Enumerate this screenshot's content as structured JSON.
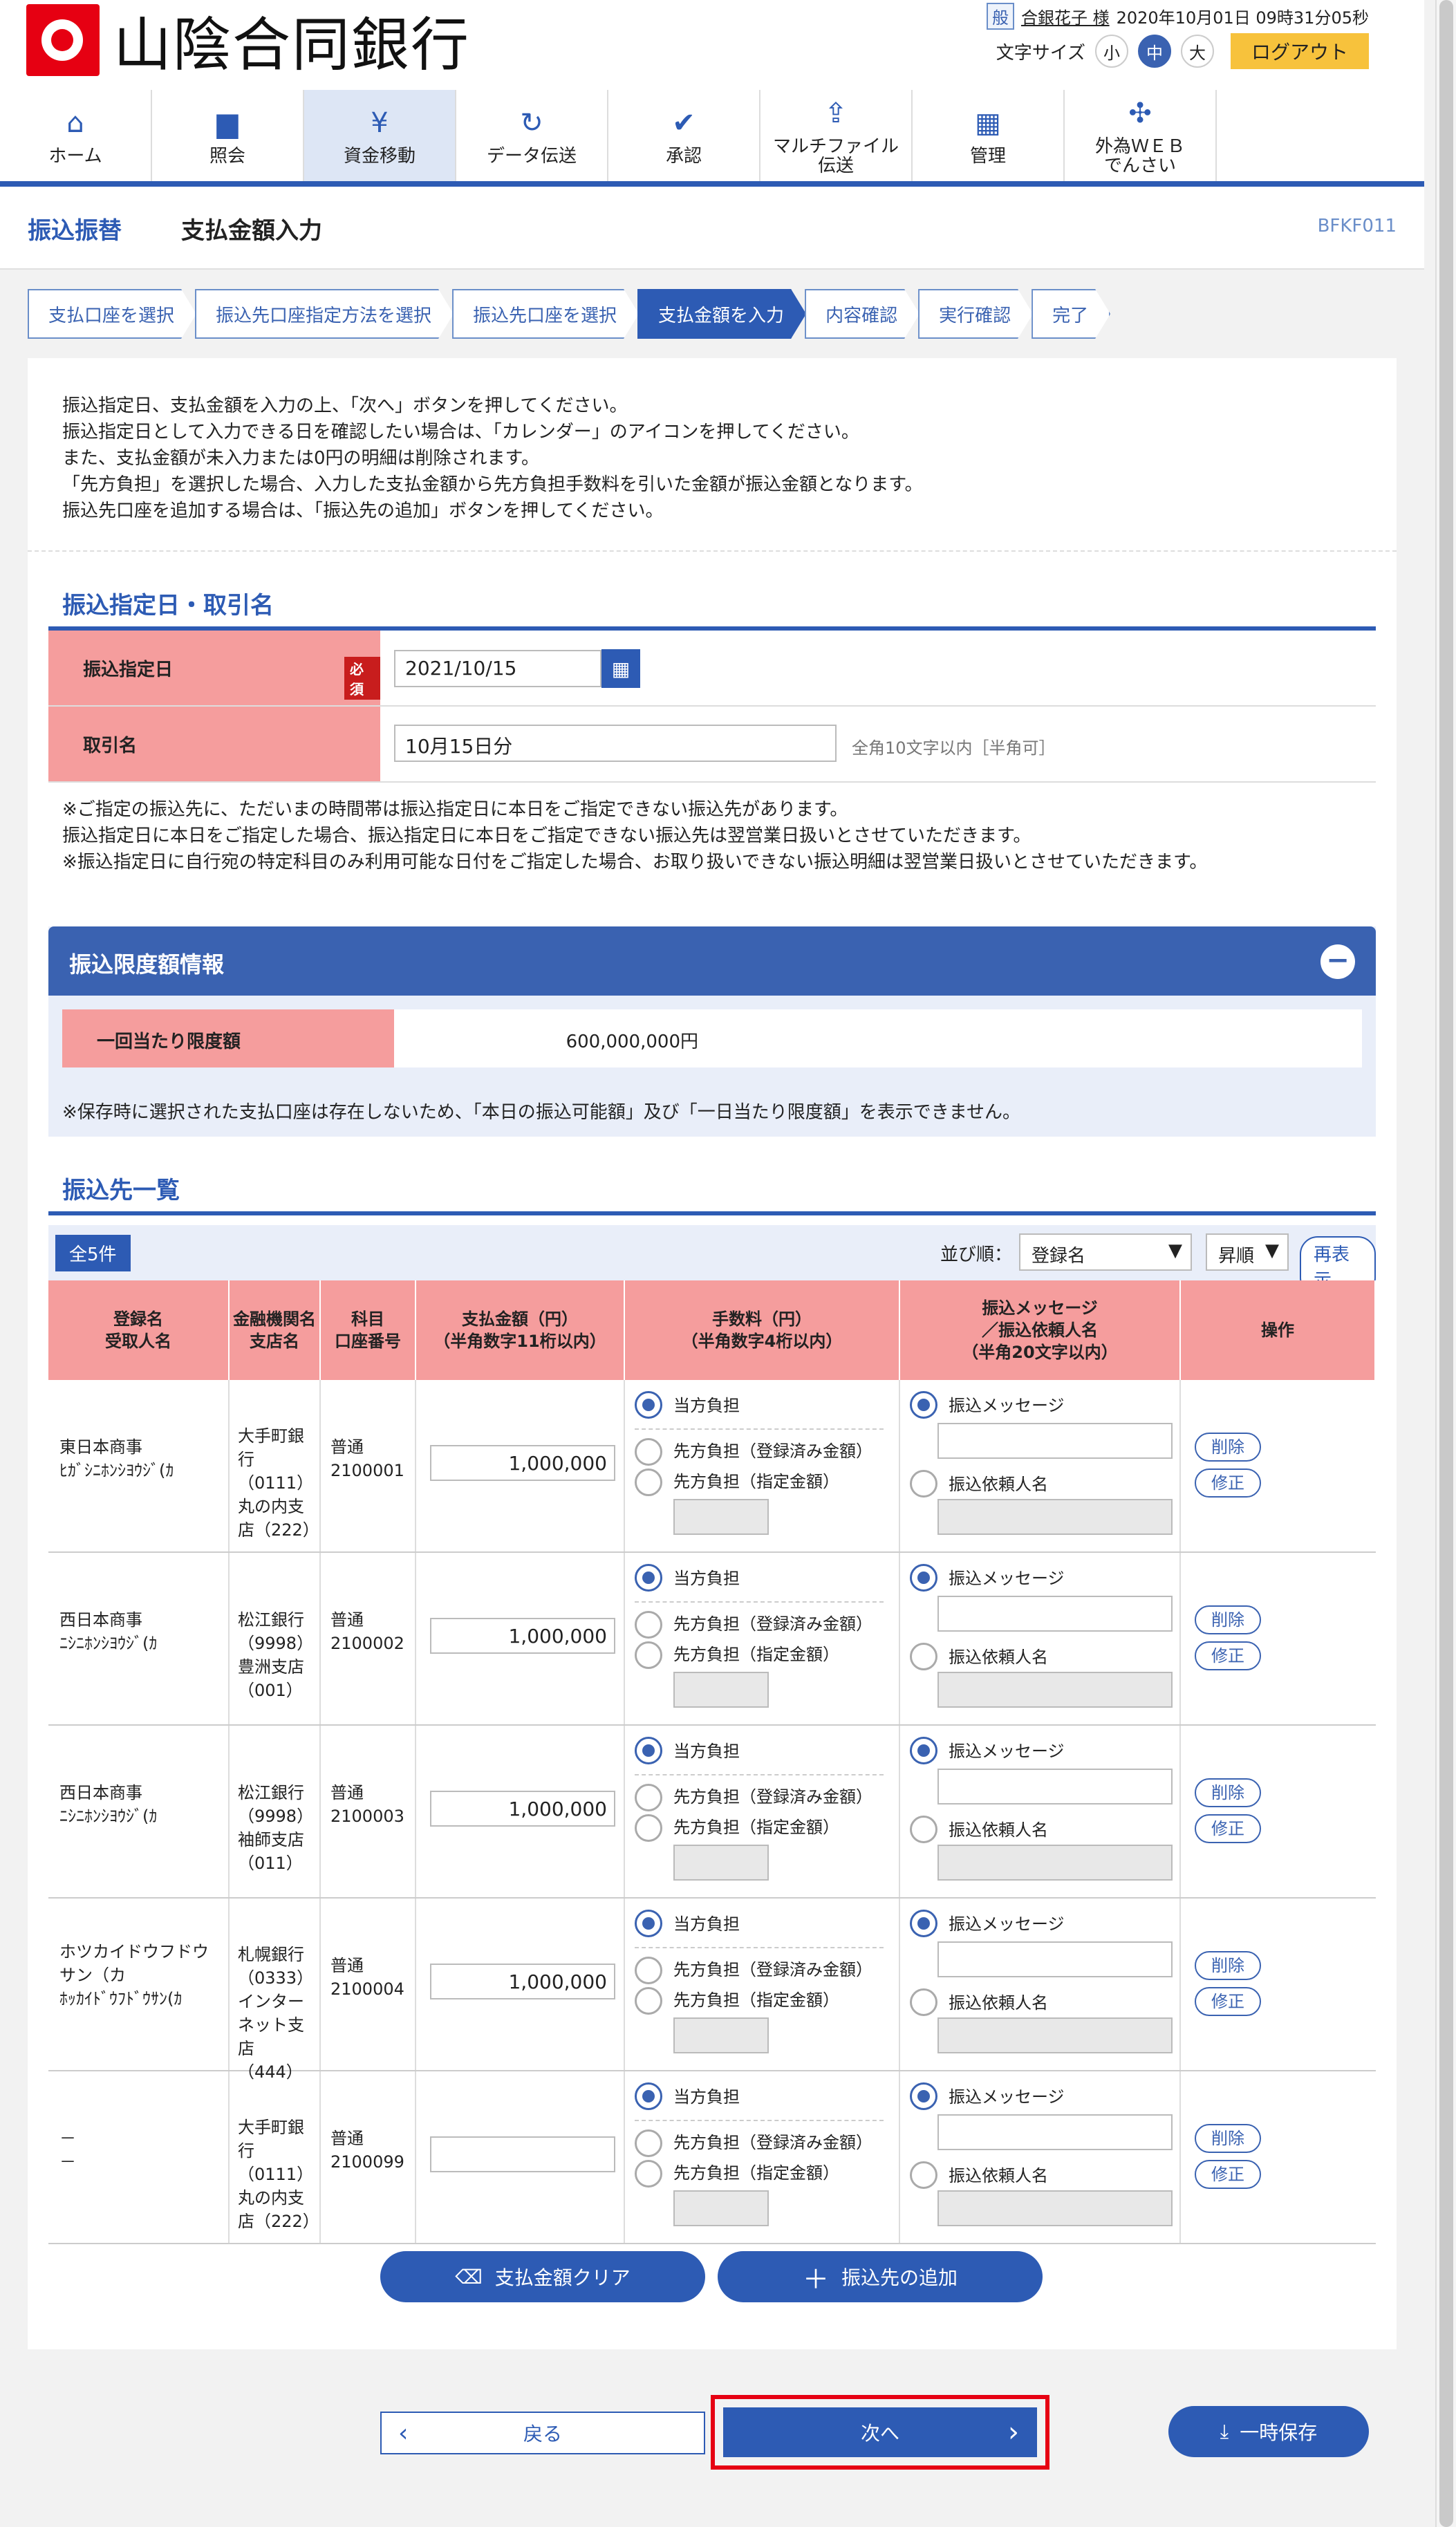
{
  "header": {
    "bank_name": "山陰合同銀行",
    "user_badge": "般",
    "user_name": "合銀花子 様",
    "datetime": "2020年10月01日 09時31分05秒",
    "font_size_label": "文字サイズ",
    "font_sizes": [
      "小",
      "中",
      "大"
    ],
    "logout": "ログアウト"
  },
  "nav": [
    {
      "label": "ホーム",
      "icon": "home-icon",
      "glyph": "⌂"
    },
    {
      "label": "照会",
      "icon": "document-icon",
      "glyph": "▆"
    },
    {
      "label": "資金移動",
      "icon": "yen-transfer-icon",
      "glyph": "¥"
    },
    {
      "label": "データ伝送",
      "icon": "refresh-icon",
      "glyph": "↻"
    },
    {
      "label": "承認",
      "icon": "approve-icon",
      "glyph": "✔"
    },
    {
      "label": "マルチファイル\n伝送",
      "icon": "file-upload-icon",
      "glyph": "⇪"
    },
    {
      "label": "管理",
      "icon": "building-icon",
      "glyph": "▦"
    },
    {
      "label": "外為ＷＥＢ\nでんさい",
      "icon": "network-icon",
      "glyph": "✣"
    }
  ],
  "page": {
    "section": "振込振替",
    "title": "支払金額入力",
    "code": "BFKF011"
  },
  "steps": [
    "支払口座を選択",
    "振込先口座指定方法を選択",
    "振込先口座を選択",
    "支払金額を入力",
    "内容確認",
    "実行確認",
    "完了"
  ],
  "instructions": [
    "振込指定日、支払金額を入力の上、「次へ」ボタンを押してください。",
    "振込指定日として入力できる日を確認したい場合は、「カレンダー」のアイコンを押してください。",
    "また、支払金額が未入力または0円の明細は削除されます。",
    "「先方負担」を選択した場合、入力した支払金額から先方負担手数料を引いた金額が振込金額となります。",
    "振込先口座を追加する場合は、「振込先の追加」ボタンを押してください。"
  ],
  "date_section": {
    "title": "振込指定日・取引名",
    "date_label": "振込指定日",
    "required": "必須",
    "date_value": "2021/10/15",
    "name_label": "取引名",
    "name_value": "10月15日分",
    "name_hint": "全角10文字以内［半角可］"
  },
  "notes": [
    "※ご指定の振込先に、ただいまの時間帯は振込指定日に本日をご指定できない振込先があります。",
    "振込指定日に本日をご指定した場合、振込指定日に本日をご指定できない振込先は翌営業日扱いとさせていただきます。",
    "※振込指定日に自行宛の特定科目のみ利用可能な日付をご指定した場合、お取り扱いできない振込明細は翌営業日扱いとさせていただきます。"
  ],
  "limit": {
    "title": "振込限度額情報",
    "label": "一回当たり限度額",
    "value": "600,000,000円",
    "note": "※保存時に選択された支払口座は存在しないため、「本日の振込可能額」及び「一日当たり限度額」を表示できません。"
  },
  "list": {
    "title": "振込先一覧",
    "count": "全5件",
    "sort_label": "並び順：",
    "sort_value": "登録名",
    "order_value": "昇順",
    "redisplay": "再表示",
    "headers": [
      "登録名\n受取人名",
      "金融機関名\n支店名",
      "科目\n口座番号",
      "支払金額（円）\n（半角数字11桁以内）",
      "手数料（円）\n（半角数字4桁以内）",
      "振込メッセージ\n／振込依頼人名\n（半角20文字以内）",
      "操作"
    ],
    "fee_options": [
      "当方負担",
      "先方負担（登録済み金額）",
      "先方負担（指定金額）"
    ],
    "msg_options": [
      "振込メッセージ",
      "振込依頼人名"
    ],
    "delete": "削除",
    "edit": "修正",
    "rows": [
      {
        "name": "東日本商事\nﾋｶﾞｼﾆﾎﾝｼﾖｳｼﾞ(ｶ",
        "bank": "大手町銀行\n（0111）\n丸の内支店（222）",
        "account": "普通\n2100001",
        "amount": "1,000,000"
      },
      {
        "name": "西日本商事\nﾆｼﾆﾎﾝｼﾖｳｼﾞ(ｶ",
        "bank": "松江銀行（9998）\n豊洲支店（001）",
        "account": "普通\n2100002",
        "amount": "1,000,000"
      },
      {
        "name": "西日本商事\nﾆｼﾆﾎﾝｼﾖｳｼﾞ(ｶ",
        "bank": "松江銀行（9998）\n袖師支店（011）",
        "account": "普通\n2100003",
        "amount": "1,000,000"
      },
      {
        "name": "ホツカイドウフドウ\nサン（カ\nﾎｯｶｲﾄﾞｳﾌﾄﾞｳｻﾝ(ｶ",
        "bank": "札幌銀行（0333）\nインターネット支店\n（444）",
        "account": "普通\n2100004",
        "amount": "1,000,000"
      },
      {
        "name": "－\n－",
        "bank": "大手町銀行\n（0111）\n丸の内支店（222）",
        "account": "普通\n2100099",
        "amount": ""
      }
    ]
  },
  "buttons": {
    "clear": "支払金額クリア",
    "add": "振込先の追加",
    "back": "戻る",
    "next": "次へ",
    "save": "一時保存"
  }
}
